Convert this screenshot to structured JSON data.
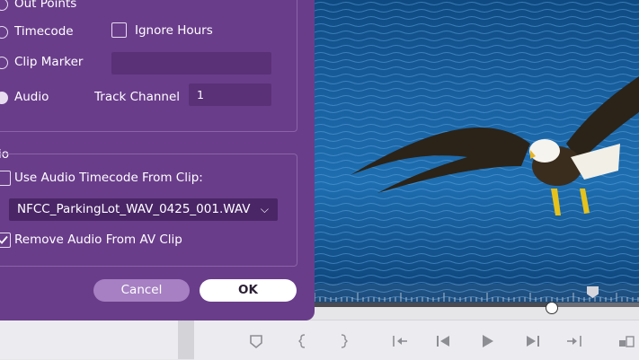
{
  "dialog": {
    "timecode_source": {
      "options": [
        {
          "label": "Out Points",
          "selected": false
        },
        {
          "label": "Timecode",
          "selected": false
        },
        {
          "label": "Clip Marker",
          "selected": false
        },
        {
          "label": "Audio",
          "selected": true
        }
      ],
      "ignore_hours_label": "Ignore Hours",
      "ignore_hours_checked": false,
      "clip_marker_value": "",
      "track_channel_label": "Track Channel",
      "track_channel_value": "1"
    },
    "audio_section": {
      "title": "io",
      "use_audio_timecode_label": "Use Audio Timecode From Clip:",
      "use_audio_timecode_checked": false,
      "selected_audio_file": "NFCC_ParkingLot_WAV_0425_001.WAV",
      "remove_audio_label": "Remove Audio From AV Clip",
      "remove_audio_checked": true
    },
    "cancel_label": "Cancel",
    "ok_label": "OK"
  },
  "viewer": {
    "playhead_position": 0.73
  },
  "transport": {
    "buttons": [
      "marker-icon",
      "mark-in-icon",
      "mark-out-icon",
      "go-to-in-icon",
      "step-back-icon",
      "play-icon",
      "step-forward-icon",
      "go-to-out-icon",
      "overwrite-icon"
    ]
  },
  "colors": {
    "dialog_bg": "#6a3d8b",
    "ok_button": "#ffffff",
    "cancel_button": "#a680c2"
  }
}
